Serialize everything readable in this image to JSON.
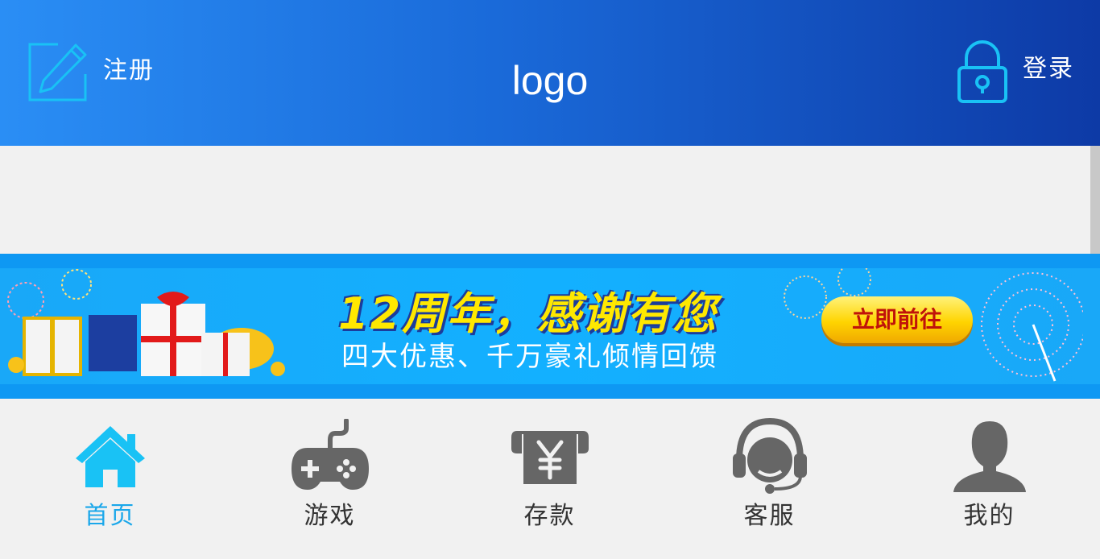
{
  "header": {
    "register_label": "注册",
    "logo_text": "logo",
    "login_label": "登录"
  },
  "banner": {
    "title": "12周年，感谢有您",
    "subtitle": "四大优惠、千万豪礼倾情回馈",
    "cta_label": "立即前往"
  },
  "nav": {
    "items": [
      {
        "label": "首页",
        "icon": "home-icon",
        "active": true
      },
      {
        "label": "游戏",
        "icon": "gamepad-icon",
        "active": false
      },
      {
        "label": "存款",
        "icon": "deposit-icon",
        "active": false
      },
      {
        "label": "客服",
        "icon": "customer-service-icon",
        "active": false
      },
      {
        "label": "我的",
        "icon": "user-icon",
        "active": false
      }
    ]
  },
  "colors": {
    "header_start": "#2a8ef5",
    "header_end": "#0d3aa6",
    "accent": "#1aa7ea",
    "icon_gray": "#666666"
  }
}
